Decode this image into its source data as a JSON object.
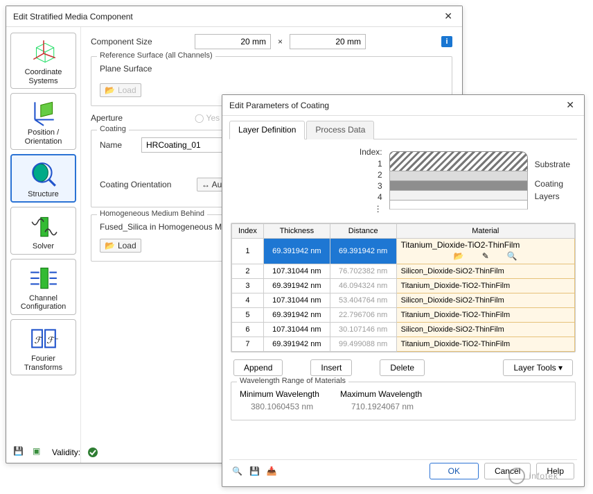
{
  "win1": {
    "title": "Edit Stratified Media Component",
    "sidebar": [
      {
        "label": "Coordinate Systems"
      },
      {
        "label": "Position / Orientation"
      },
      {
        "label": "Structure"
      },
      {
        "label": "Solver"
      },
      {
        "label": "Channel Configuration"
      },
      {
        "label": "Fourier Transforms"
      }
    ],
    "comp_size_label": "Component Size",
    "size_w": "20 mm",
    "size_h": "20 mm",
    "times": "×",
    "ref_surface_legend": "Reference Surface (all Channels)",
    "plane_surface": "Plane Surface",
    "load": "Load",
    "aperture": "Aperture",
    "aperture_yes": "Yes",
    "coating_legend": "Coating",
    "name_label": "Name",
    "coating_name": "HRCoating_01",
    "coat_orient_label": "Coating Orientation",
    "coat_orient_value": "↔ Auto",
    "hom_medium_legend": "Homogeneous Medium Behind",
    "hom_medium_value": "Fused_Silica in Homogeneous M",
    "validity": "Validity:"
  },
  "win2": {
    "title": "Edit Parameters of Coating",
    "tabs": {
      "t1": "Layer Definition",
      "t2": "Process Data"
    },
    "diagram": {
      "index_label": "Index:",
      "indices": "1\n2\n3\n4\n⋮",
      "substrate": "Substrate",
      "coating_layers": "Coating\nLayers"
    },
    "headers": {
      "index": "Index",
      "thickness": "Thickness",
      "distance": "Distance",
      "material": "Material"
    },
    "rows": [
      {
        "i": "1",
        "t": "69.391942 nm",
        "d": "69.391942 nm",
        "m": "Titanium_Dioxide-TiO2-ThinFilm"
      },
      {
        "i": "2",
        "t": "107.31044 nm",
        "d": "76.702382 nm",
        "m": "Silicon_Dioxide-SiO2-ThinFilm"
      },
      {
        "i": "3",
        "t": "69.391942 nm",
        "d": "46.094324 nm",
        "m": "Titanium_Dioxide-TiO2-ThinFilm"
      },
      {
        "i": "4",
        "t": "107.31044 nm",
        "d": "53.404764 nm",
        "m": "Silicon_Dioxide-SiO2-ThinFilm"
      },
      {
        "i": "5",
        "t": "69.391942 nm",
        "d": "22.796706 nm",
        "m": "Titanium_Dioxide-TiO2-ThinFilm"
      },
      {
        "i": "6",
        "t": "107.31044 nm",
        "d": "30.107146 nm",
        "m": "Silicon_Dioxide-SiO2-ThinFilm"
      },
      {
        "i": "7",
        "t": "69.391942 nm",
        "d": "99.499088 nm",
        "m": "Titanium_Dioxide-TiO2-ThinFilm"
      }
    ],
    "buttons": {
      "append": "Append",
      "insert": "Insert",
      "delete": "Delete",
      "tools": "Layer Tools"
    },
    "wave": {
      "legend": "Wavelength Range of Materials",
      "min_label": "Minimum Wavelength",
      "max_label": "Maximum Wavelength",
      "min": "380.1060453 nm",
      "max": "710.1924067 nm"
    },
    "footer": {
      "ok": "OK",
      "cancel": "Cancel",
      "help": "Help"
    }
  },
  "watermark": "infotek"
}
